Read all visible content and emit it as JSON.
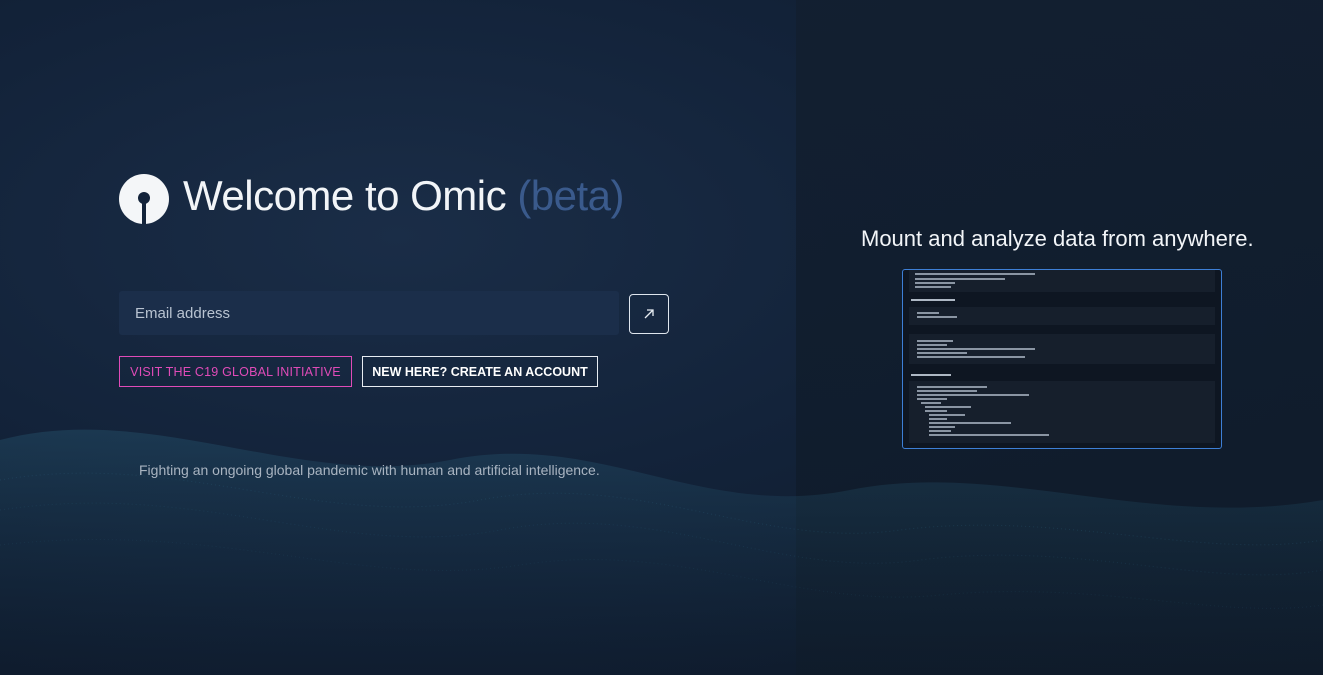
{
  "hero": {
    "title": "Welcome to Omic",
    "title_beta": "(beta)"
  },
  "form": {
    "email_placeholder": "Email address"
  },
  "buttons": {
    "c19_label": "VISIT THE C19 GLOBAL INITIATIVE",
    "create_label": "NEW HERE? CREATE AN ACCOUNT"
  },
  "tagline": "Fighting an ongoing global pandemic with human and artificial intelligence.",
  "promo": {
    "headline": "Mount and analyze data from anywhere."
  },
  "colors": {
    "accent_pink": "#e04bb8",
    "beta_blue": "#3a5a8c",
    "preview_border": "#3d7fd6"
  },
  "icons": {
    "logo": "omic-logo-icon",
    "submit": "arrow-up-right-icon"
  }
}
